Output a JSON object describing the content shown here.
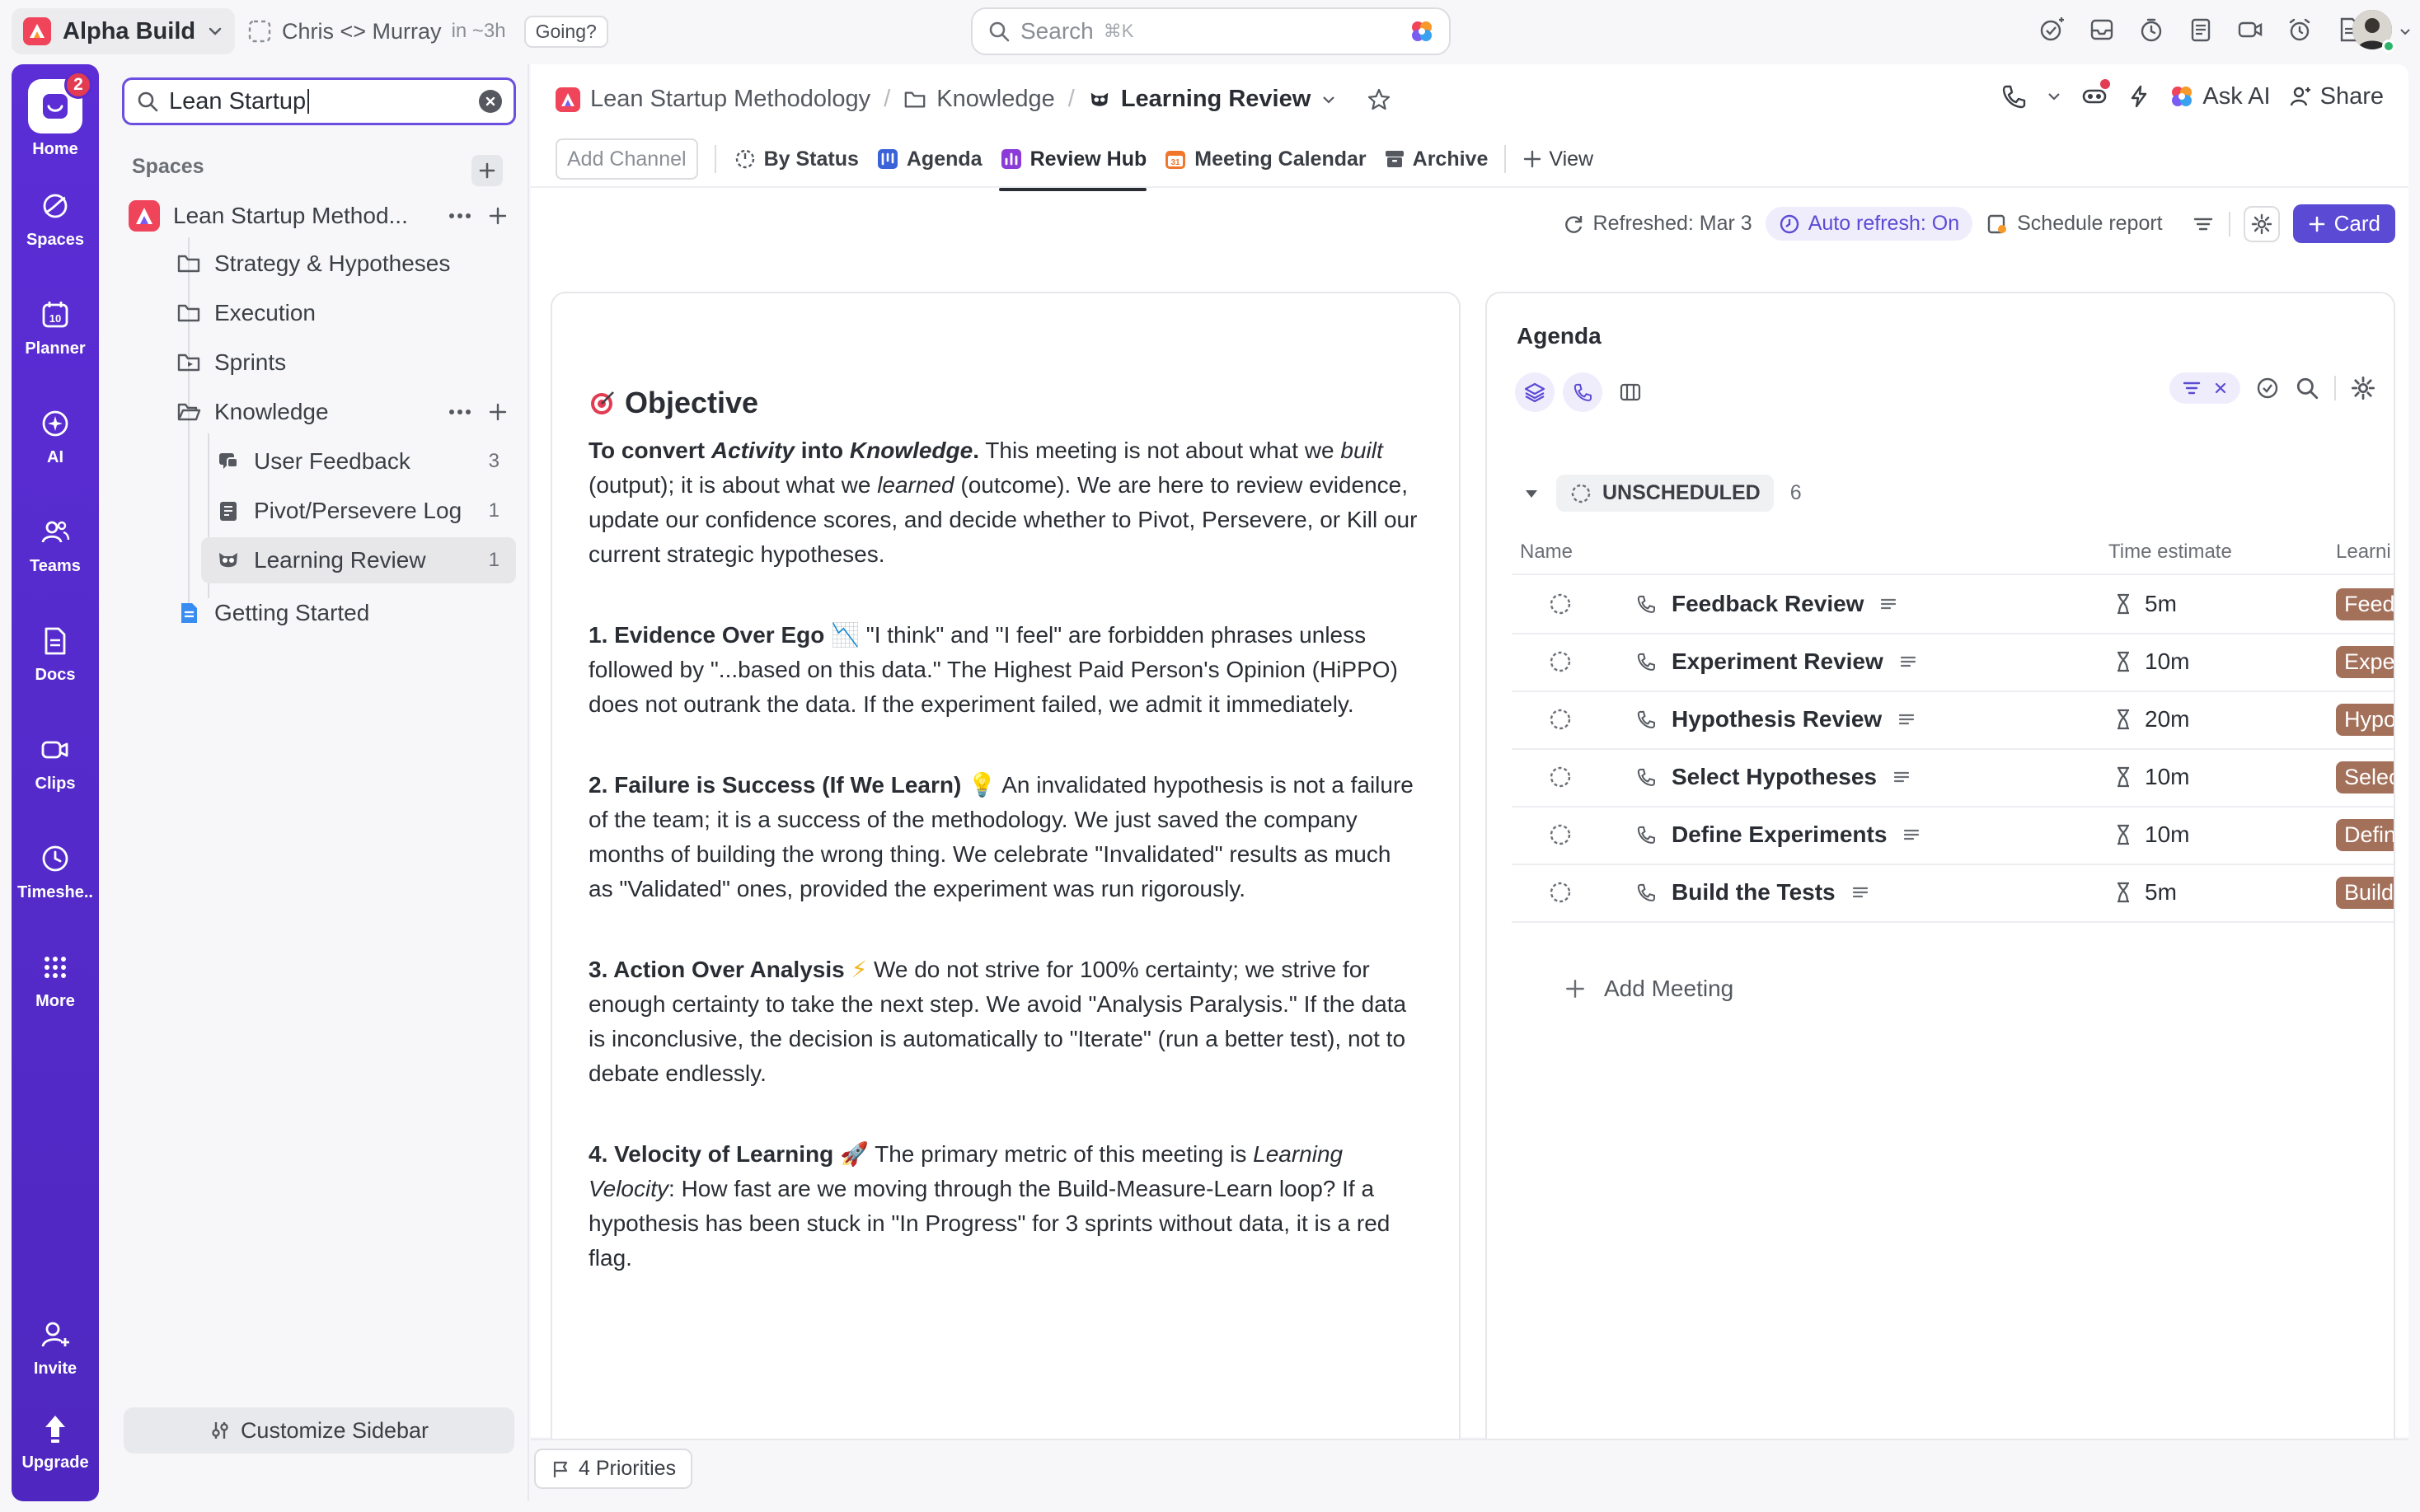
{
  "topbar": {
    "workspace": "Alpha Build",
    "meeting_title": "Chris <> Murray",
    "meeting_time": "in ~3h",
    "going": "Going?",
    "search_placeholder": "Search",
    "search_shortcut": "⌘K"
  },
  "rail": {
    "home_badge": "2",
    "items": [
      {
        "label": "Home",
        "icon": "home-icon"
      },
      {
        "label": "Spaces",
        "icon": "spaces-icon"
      },
      {
        "label": "Planner",
        "icon": "planner-icon"
      },
      {
        "label": "AI",
        "icon": "ai-icon"
      },
      {
        "label": "Teams",
        "icon": "teams-icon"
      },
      {
        "label": "Docs",
        "icon": "docs-icon"
      },
      {
        "label": "Clips",
        "icon": "clips-icon"
      },
      {
        "label": "Timeshe..",
        "icon": "timesheet-icon"
      },
      {
        "label": "More",
        "icon": "more-icon"
      },
      {
        "label": "Invite",
        "icon": "invite-icon"
      },
      {
        "label": "Upgrade",
        "icon": "upgrade-icon"
      }
    ],
    "planner_day": "10"
  },
  "sidebar": {
    "search_value": "Lean Startup",
    "spaces_label": "Spaces",
    "space_name": "Lean Startup Method...",
    "items": [
      {
        "label": "Strategy & Hypotheses"
      },
      {
        "label": "Execution"
      },
      {
        "label": "Sprints"
      },
      {
        "label": "Knowledge"
      },
      {
        "label": "User Feedback",
        "count": "3"
      },
      {
        "label": "Pivot/Persevere Log",
        "count": "1"
      },
      {
        "label": "Learning Review",
        "count": "1"
      },
      {
        "label": "Getting Started"
      }
    ],
    "customize": "Customize Sidebar"
  },
  "main": {
    "breadcrumb": [
      "Lean Startup Methodology",
      "Knowledge",
      "Learning Review"
    ],
    "ask_ai": "Ask AI",
    "share": "Share",
    "tabs": {
      "add_channel": "Add Channel",
      "items": [
        "By Status",
        "Agenda",
        "Review Hub",
        "Meeting Calendar",
        "Archive"
      ],
      "view": "View"
    },
    "toolbar": {
      "refreshed": "Refreshed: Mar 3",
      "auto_refresh": "Auto refresh: On",
      "schedule": "Schedule report",
      "card": "Card"
    }
  },
  "doc": {
    "heading": "Objective",
    "p1_b1": "To convert ",
    "p1_i1": "Activity",
    "p1_b2": " into ",
    "p1_i2": "Knowledge",
    "p1_b3": ".",
    "p1_t1": " This meeting is not about what we ",
    "p1_i3": "built",
    "p1_t2": " (output); it is about what we ",
    "p1_i4": "learned",
    "p1_t3": " (outcome). We are here to review evidence, update our confidence scores, and decide whether to Pivot, Persevere, or Kill our current strategic hypotheses.",
    "p2_b": "1. Evidence Over Ego",
    "p2_t": " \"I think\" and \"I feel\" are forbidden phrases unless followed by \"...based on this data.\" The Highest Paid Person's Opinion (HiPPO) does not outrank the data. If the experiment failed, we admit it immediately.",
    "p3_b": "2. Failure is Success (If We Learn)",
    "p3_t": " An invalidated hypothesis is not a failure of the team; it is a success of the methodology. We just saved the company months of building the wrong thing. We celebrate \"Invalidated\" results as much as \"Validated\" ones, provided the experiment was run rigorously.",
    "p4_b": "3. Action Over Analysis",
    "p4_t": " We do not strive for 100% certainty; we strive for enough certainty to take the next step. We avoid \"Analysis Paralysis.\" If the data is inconclusive, the decision is automatically to \"Iterate\" (run a better test), not to debate endlessly.",
    "p5_b": "4. Velocity of Learning",
    "p5_t1": " The primary metric of this meeting is ",
    "p5_i": "Learning Velocity",
    "p5_t2": ": How fast are we moving through the Build-Measure-Learn loop? If a hypothesis has been stuck in \"In Progress\" for 3 sprints without data, it is a red flag."
  },
  "agenda": {
    "title": "Agenda",
    "group": "UNSCHEDULED",
    "group_count": "6",
    "columns": [
      "Name",
      "Time estimate",
      "Learni"
    ],
    "rows": [
      {
        "name": "Feedback Review",
        "estimate": "5m",
        "tag": "Feed"
      },
      {
        "name": "Experiment Review",
        "estimate": "10m",
        "tag": "Expe"
      },
      {
        "name": "Hypothesis Review",
        "estimate": "20m",
        "tag": "Hypo"
      },
      {
        "name": "Select Hypotheses",
        "estimate": "10m",
        "tag": "Selec"
      },
      {
        "name": "Define Experiments",
        "estimate": "10m",
        "tag": "Defin"
      },
      {
        "name": "Build the Tests",
        "estimate": "5m",
        "tag": "Build"
      }
    ],
    "add_meeting": "Add Meeting"
  },
  "footer": {
    "priorities": "4 Priorities"
  }
}
